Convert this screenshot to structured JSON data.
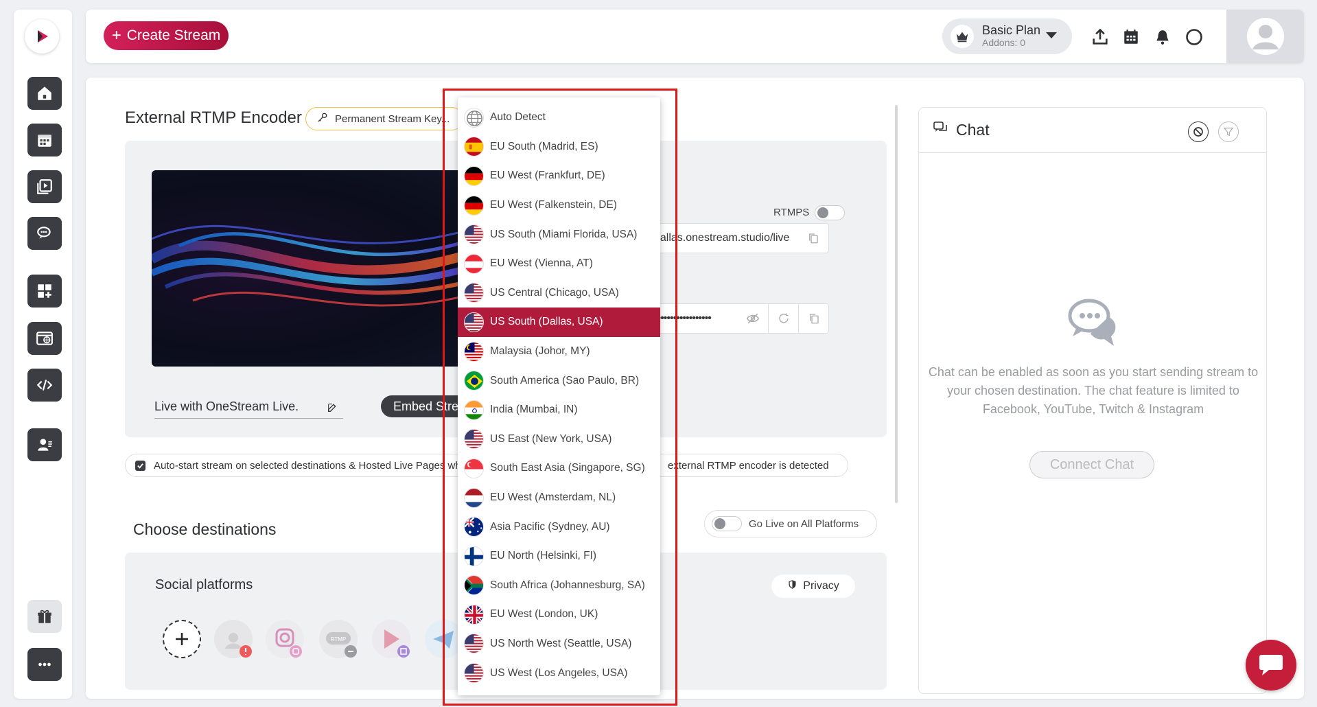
{
  "topbar": {
    "create_label": "Create Stream",
    "plan_name": "Basic Plan",
    "plan_addons": "Addons: 0"
  },
  "encoder": {
    "title": "External RTMP Encoder",
    "perm_key_label": "Permanent Stream Key...",
    "rtmps_label": "RTMPS",
    "server_url": "dallas.onestream.studio/live",
    "stream_key": "••••••••••••••••••",
    "stream_title": "Live with OneStream Live.",
    "embed_label": "Embed Stream"
  },
  "autostart": {
    "lead": "Auto-start stream on selected destinations & Hosted Live Pages when",
    "tail": "external RTMP encoder is detected"
  },
  "destinations": {
    "title": "Choose destinations",
    "go_live_all": "Go Live on All Platforms",
    "social_title": "Social platforms",
    "privacy_label": "Privacy"
  },
  "chat": {
    "title": "Chat",
    "empty_message": "Chat can be enabled as soon as you start sending stream to your chosen destination. The chat feature is limited to Facebook, YouTube, Twitch & Instagram",
    "connect_label": "Connect Chat"
  },
  "server_dropdown": {
    "selected": "US South (Dallas, USA)",
    "options": [
      {
        "label": "Auto Detect",
        "flag": "globe"
      },
      {
        "label": "EU South (Madrid, ES)",
        "flag": "es"
      },
      {
        "label": "EU West (Frankfurt, DE)",
        "flag": "de"
      },
      {
        "label": "EU West (Falkenstein, DE)",
        "flag": "de"
      },
      {
        "label": "US South (Miami Florida, USA)",
        "flag": "us"
      },
      {
        "label": "EU West (Vienna, AT)",
        "flag": "at"
      },
      {
        "label": "US Central (Chicago, USA)",
        "flag": "us"
      },
      {
        "label": "US South (Dallas, USA)",
        "flag": "us"
      },
      {
        "label": "Malaysia (Johor, MY)",
        "flag": "my"
      },
      {
        "label": "South America (Sao Paulo, BR)",
        "flag": "br"
      },
      {
        "label": "India (Mumbai, IN)",
        "flag": "in"
      },
      {
        "label": "US East (New York, USA)",
        "flag": "us"
      },
      {
        "label": "South East Asia (Singapore, SG)",
        "flag": "sg"
      },
      {
        "label": "EU West (Amsterdam, NL)",
        "flag": "nl"
      },
      {
        "label": "Asia Pacific (Sydney, AU)",
        "flag": "au"
      },
      {
        "label": "EU North (Helsinki, FI)",
        "flag": "fi"
      },
      {
        "label": "South Africa (Johannesburg, SA)",
        "flag": "za"
      },
      {
        "label": "EU West (London, UK)",
        "flag": "uk"
      },
      {
        "label": "US North West (Seattle, USA)",
        "flag": "us"
      },
      {
        "label": "US West (Los Angeles, USA)",
        "flag": "us"
      }
    ]
  },
  "colors": {
    "accent": "#b01b3c",
    "dark": "#3b3d42",
    "highlight_box": "#e01717"
  }
}
